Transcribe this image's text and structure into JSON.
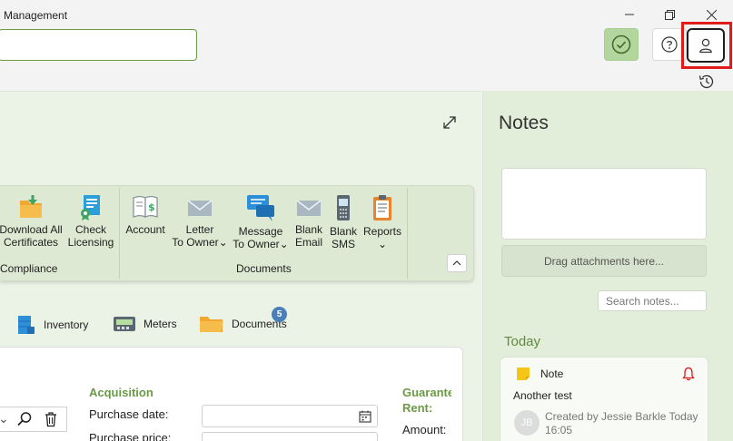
{
  "window": {
    "title": "Management"
  },
  "header": {
    "search_value": "",
    "buttons": {
      "sync": "check-circle-icon",
      "help": "help-icon",
      "user": "user-icon",
      "history": "history-icon"
    }
  },
  "ribbon": {
    "compliance": {
      "items": [
        {
          "line1": "Download All",
          "line2": "Certificates"
        },
        {
          "line1": "Check",
          "line2": "Licensing"
        }
      ],
      "group_label": "Compliance"
    },
    "documents": {
      "items": [
        {
          "line1": "Account",
          "line2": ""
        },
        {
          "line1": "Letter",
          "line2": "To Owner"
        },
        {
          "line1": "Message",
          "line2": "To Owner"
        },
        {
          "line1": "Blank",
          "line2": "Email"
        },
        {
          "line1": "Blank",
          "line2": "SMS"
        },
        {
          "line1": "Reports",
          "line2": ""
        }
      ],
      "group_label": "Documents"
    }
  },
  "tabs": [
    {
      "label": "Inventory"
    },
    {
      "label": "Meters"
    },
    {
      "label": "Documents",
      "badge": "5"
    }
  ],
  "details": {
    "acquisition_heading": "Acquisition",
    "purchase_date_label": "Purchase date:",
    "purchase_price_label": "Purchase price:",
    "guarantee_heading_1": "Guarantee",
    "guarantee_heading_2": "Rent:",
    "amount_label": "Amount:"
  },
  "notes": {
    "title": "Notes",
    "drag_text": "Drag attachments here...",
    "search_placeholder": "Search notes...",
    "group_label": "Today",
    "items": [
      {
        "type": "Note",
        "text": "Another test",
        "author_initials": "JB",
        "meta_line1": "Created by Jessie Barkle Today",
        "meta_line2": "16:05"
      }
    ]
  },
  "colors": {
    "accent": "#6b9a45",
    "highlight": "#e11b1b",
    "panel": "#e3eeda",
    "ribbon": "#dde9d2"
  }
}
